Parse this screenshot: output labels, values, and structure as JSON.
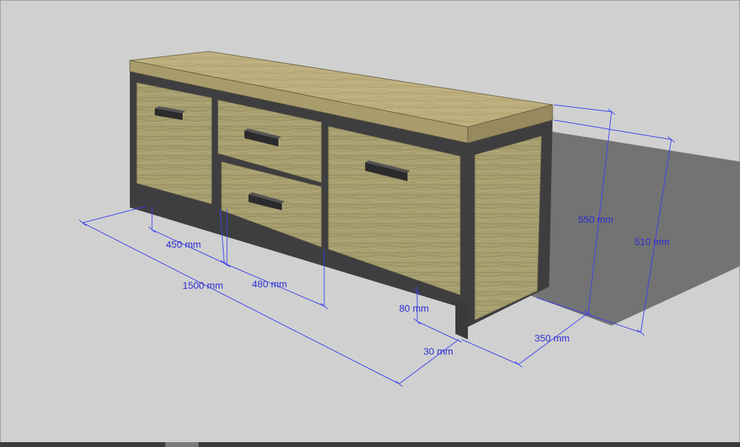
{
  "model": {
    "colors": {
      "background": "#d0d0d0",
      "shadow": "#737373",
      "frame": "#3e3e40",
      "wood_top": "#b9ab78",
      "wood_front": "#a39a6d",
      "wood_side": "#9d9464",
      "handle": "#2b2b2d",
      "dimension": "#2a2fd0"
    },
    "dimensions": {
      "d450": "450 mm",
      "d480": "480 mm",
      "d1500": "1500 mm",
      "d80": "80 mm",
      "d30": "30 mm",
      "d350": "350 mm",
      "d550": "550 mm",
      "d510": "510 mm"
    }
  }
}
